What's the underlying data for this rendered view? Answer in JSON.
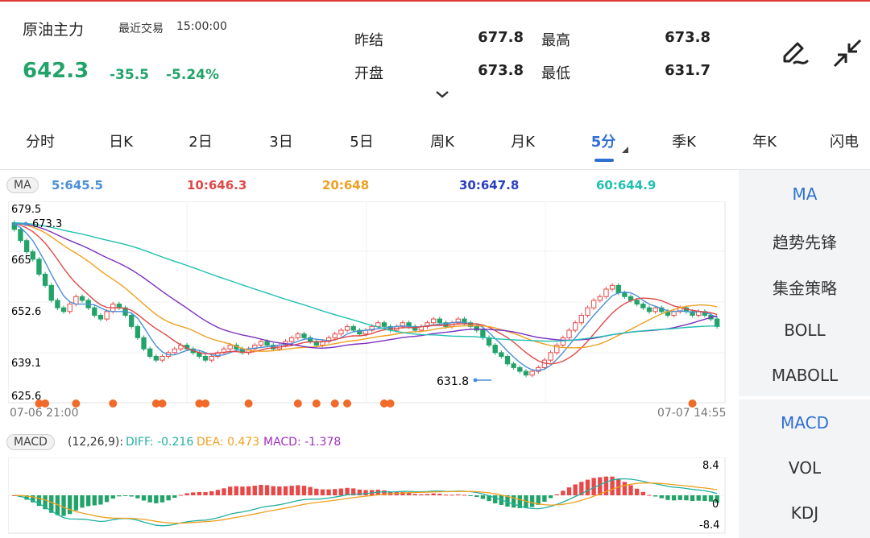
{
  "header": {
    "name": "原油主力",
    "recent_label": "最近交易",
    "recent_time": "15:00:00",
    "price": "642.3",
    "change": "-35.5",
    "change_pct": "-5.24%",
    "stats": [
      {
        "label": "昨结",
        "value": "677.8"
      },
      {
        "label": "最高",
        "value": "673.8"
      },
      {
        "label": "开盘",
        "value": "673.8"
      },
      {
        "label": "最低",
        "value": "631.7"
      }
    ],
    "icons": [
      "chevron-down-icon",
      "pen-icon",
      "shrink-icon"
    ]
  },
  "tabs": [
    "分时",
    "日K",
    "2日",
    "3日",
    "5日",
    "周K",
    "月K",
    "5分",
    "季K",
    "年K",
    "闪电"
  ],
  "active_tab": "5分",
  "ma_bar": {
    "label": "MA",
    "items": [
      {
        "text": "5:645.5",
        "color": "#4a8fd8"
      },
      {
        "text": "10:646.3",
        "color": "#e04848"
      },
      {
        "text": "20:648",
        "color": "#f0a020"
      },
      {
        "text": "30:647.8",
        "color": "#2a3fc0"
      },
      {
        "text": "60:644.9",
        "color": "#20c0b0"
      }
    ]
  },
  "macd_bar": {
    "label": "MACD",
    "params": "(12,26,9):",
    "diff": "DIFF: -0.216",
    "dea": "DEA: 0.473",
    "macd": "MACD: -1.378",
    "colors": {
      "diff": "#20b0a0",
      "dea": "#f0a020",
      "macd": "#a030c0"
    }
  },
  "right_panel": {
    "main_items": [
      "MA",
      "趋势先锋",
      "集金策略",
      "BOLL",
      "MABOLL"
    ],
    "main_active": "MA",
    "sub_items": [
      "MACD",
      "VOL",
      "KDJ"
    ],
    "sub_active": "MACD"
  },
  "chart_data": [
    {
      "type": "candlestick",
      "y_ticks": [
        "679.5",
        "665",
        "652.6",
        "639.1",
        "625.6"
      ],
      "ylim": [
        625.6,
        679.5
      ],
      "x_labels": [
        "07-06 21:00",
        "07-07 14:55"
      ],
      "annotations": {
        "high": "673.3",
        "low": "631.8"
      },
      "colors": {
        "up": "#e84848",
        "down": "#22a36a"
      },
      "close": [
        672,
        669,
        666,
        664,
        660,
        657,
        653,
        651,
        650,
        652,
        654,
        653,
        651,
        649,
        648,
        650,
        652,
        651,
        649,
        646,
        643,
        640,
        638,
        637,
        638,
        639,
        640,
        641,
        640,
        639,
        638,
        637,
        638,
        639,
        640,
        641,
        640,
        639,
        640,
        641,
        642,
        641,
        640,
        641,
        642,
        643,
        644,
        643,
        642,
        641,
        642,
        643,
        644,
        645,
        646,
        645,
        644,
        645,
        646,
        647,
        646,
        645,
        646,
        647,
        646,
        645,
        646,
        647,
        648,
        647,
        646,
        647,
        648,
        647,
        646,
        645,
        643,
        641,
        639,
        638,
        636,
        635,
        634,
        633,
        634,
        635,
        637,
        639,
        641,
        643,
        645,
        647,
        649,
        651,
        653,
        654,
        656,
        657,
        655,
        654,
        653,
        652,
        651,
        650,
        651,
        650,
        649,
        650,
        651,
        650,
        649,
        650,
        649,
        648,
        646
      ],
      "markers": [
        "red dots at buy/sell signals along baseline"
      ],
      "series": [
        {
          "name": "5",
          "color": "#4a8fd8"
        },
        {
          "name": "10",
          "color": "#e04848"
        },
        {
          "name": "20",
          "color": "#f0a020"
        },
        {
          "name": "30",
          "color": "#7a30c0"
        },
        {
          "name": "60",
          "color": "#20c0b0"
        }
      ]
    },
    {
      "type": "bar",
      "y_ticks": [
        "8.4",
        "0",
        "-8.4"
      ],
      "ylim": [
        -8.4,
        8.4
      ]
    }
  ]
}
